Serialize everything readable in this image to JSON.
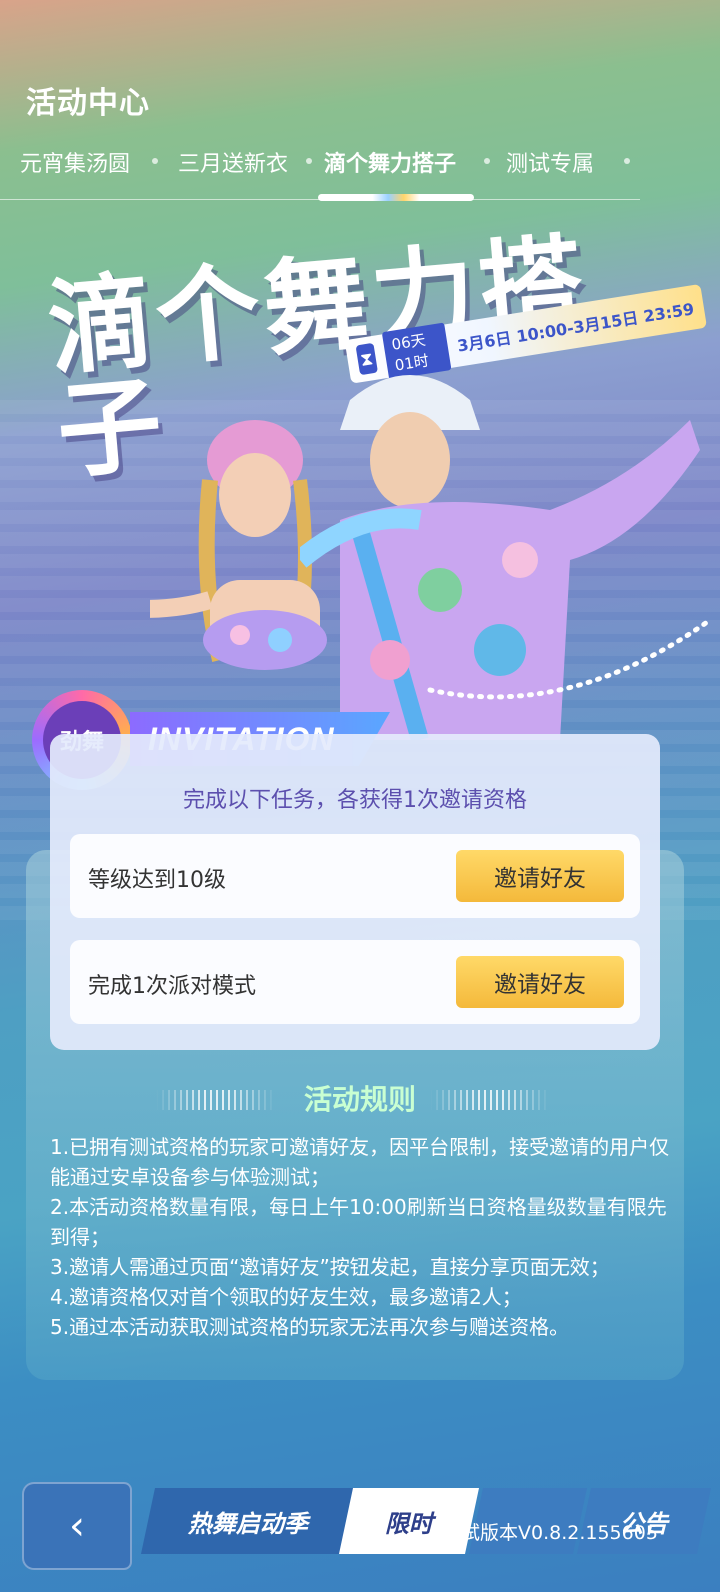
{
  "header": {
    "title_strong": "活动",
    "title_rest": "中心"
  },
  "tabs": [
    {
      "label": "元宵集汤圆"
    },
    {
      "label": "三月送新衣"
    },
    {
      "label": "滴个舞力搭子"
    },
    {
      "label": "测试专属"
    }
  ],
  "hero": {
    "title": "滴个舞力搭子",
    "countdown": "06天01时",
    "time_range": "3月6日 10:00-3月15日 23:59"
  },
  "badge": {
    "text": "劲舞"
  },
  "invitation": {
    "ribbon": "INVITATION",
    "subtitle": "完成以下任务，各获得1次邀请资格",
    "tasks": [
      {
        "label": "等级达到10级",
        "button": "邀请好友"
      },
      {
        "label": "完成1次派对模式",
        "button": "邀请好友"
      }
    ]
  },
  "rules": {
    "heading": "活动规则",
    "items": [
      "1.已拥有测试资格的玩家可邀请好友，因平台限制，接受邀请的用户仅能通过安卓设备参与体验测试；",
      "2.本活动资格数量有限，每日上午10:00刷新当日资格量级数量有限先到得；",
      "3.邀请人需通过页面“邀请好友”按钮发起，直接分享页面无效；",
      "4.邀请资格仅对首个领取的好友生效，最多邀请2人；",
      "5.通过本活动获取测试资格的玩家无法再次参与赠送资格。"
    ]
  },
  "bottom": {
    "back": "‹",
    "tab_hot": "热舞启动季",
    "tab_limited": "限时",
    "tab_3": "",
    "tab_4": "公告",
    "version": "测试版本V0.8.2.155605"
  },
  "colors": {
    "accent_blue": "#3c55c9",
    "button_yellow": "#f4b93b",
    "rules_heading": "#c9ffd2"
  }
}
